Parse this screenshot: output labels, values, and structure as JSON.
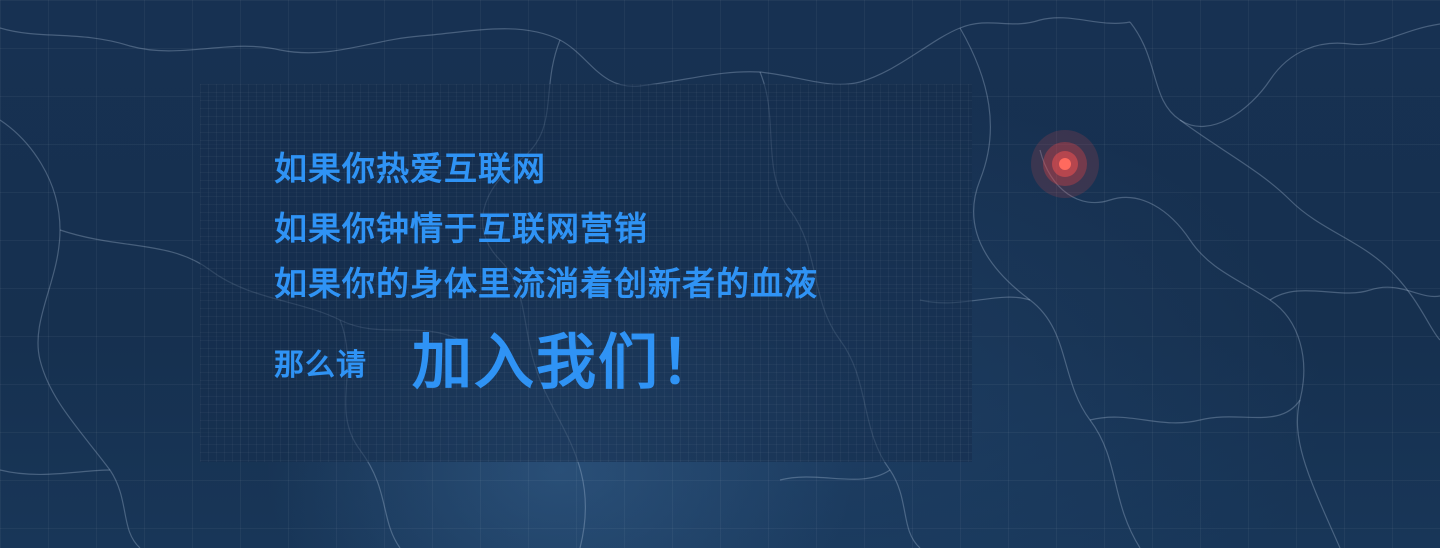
{
  "slogans": {
    "line1": "如果你热爱互联网",
    "line2": "如果你钟情于互联网营销",
    "line3": "如果你的身体里流淌着创新者的血液"
  },
  "cta": {
    "lead": "那么请",
    "main": "加入我们！"
  },
  "colors": {
    "background": "#16304f",
    "text_accent": "#2f93f5",
    "pin": "#ff6a5e"
  },
  "icons": {
    "location_pin": "location-pulse-icon"
  }
}
